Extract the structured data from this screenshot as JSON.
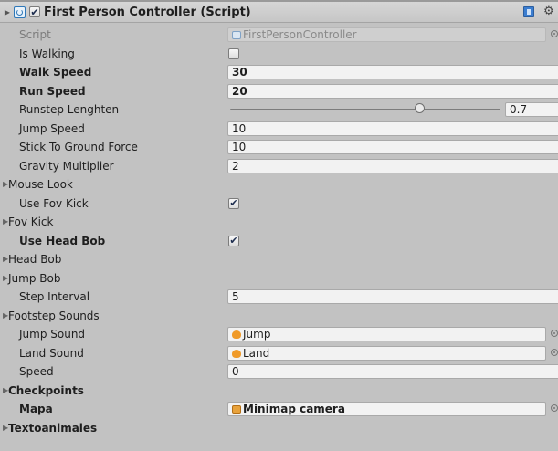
{
  "header": {
    "title": "First Person Controller (Script)",
    "enabled": true,
    "help_icon": "help-book-icon",
    "settings_icon": "gear-icon"
  },
  "rows": {
    "script": {
      "label": "Script",
      "value": "FirstPersonController"
    },
    "is_walking": {
      "label": "Is Walking",
      "checked": false
    },
    "walk_speed": {
      "label": "Walk Speed",
      "value": "30"
    },
    "run_speed": {
      "label": "Run Speed",
      "value": "20"
    },
    "runstep": {
      "label": "Runstep Lenghten",
      "value": "0.7",
      "fraction": 0.7
    },
    "jump_speed": {
      "label": "Jump Speed",
      "value": "10"
    },
    "stick_force": {
      "label": "Stick To Ground Force",
      "value": "10"
    },
    "gravity": {
      "label": "Gravity Multiplier",
      "value": "2"
    },
    "mouse_look": {
      "label": "Mouse Look"
    },
    "use_fov_kick": {
      "label": "Use Fov Kick",
      "checked": true
    },
    "fov_kick": {
      "label": "Fov Kick"
    },
    "use_head_bob": {
      "label": "Use Head Bob",
      "checked": true
    },
    "head_bob": {
      "label": "Head Bob"
    },
    "jump_bob": {
      "label": "Jump Bob"
    },
    "step_interval": {
      "label": "Step Interval",
      "value": "5"
    },
    "footstep_sounds": {
      "label": "Footstep Sounds"
    },
    "jump_sound": {
      "label": "Jump Sound",
      "value": "Jump"
    },
    "land_sound": {
      "label": "Land Sound",
      "value": "Land"
    },
    "speed": {
      "label": "Speed",
      "value": "0"
    },
    "checkpoints": {
      "label": "Checkpoints"
    },
    "mapa": {
      "label": "Mapa",
      "value": "Minimap camera"
    },
    "textoanimales": {
      "label": "Textoanimales"
    }
  },
  "glyphs": {
    "check": "✔",
    "foldout": "▶",
    "gear": "⚙"
  }
}
